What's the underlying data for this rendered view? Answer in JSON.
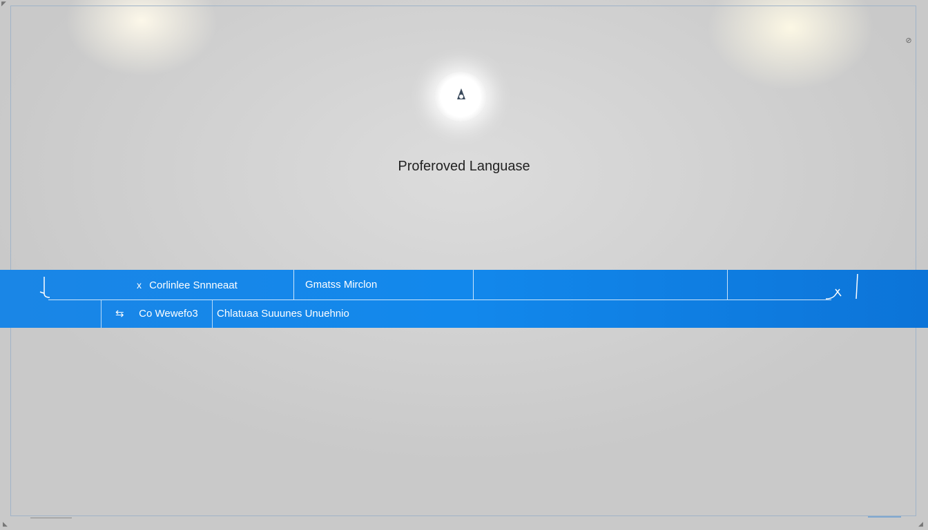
{
  "dialog": {
    "title": "Proferoved Languase",
    "spinner_icon": "loading-spinner-icon"
  },
  "selector_bar": {
    "row1": {
      "left_icon": "x",
      "left_label": "Corlinlee Snnneaat",
      "mid_label": "Gmatss Mirclon"
    },
    "row2": {
      "a_icon": "⇆",
      "a_label": "Co Wewefo3",
      "b_label": "Chlatuaa Suuunes Unuehnio"
    },
    "accent_color": "#1288ec"
  }
}
